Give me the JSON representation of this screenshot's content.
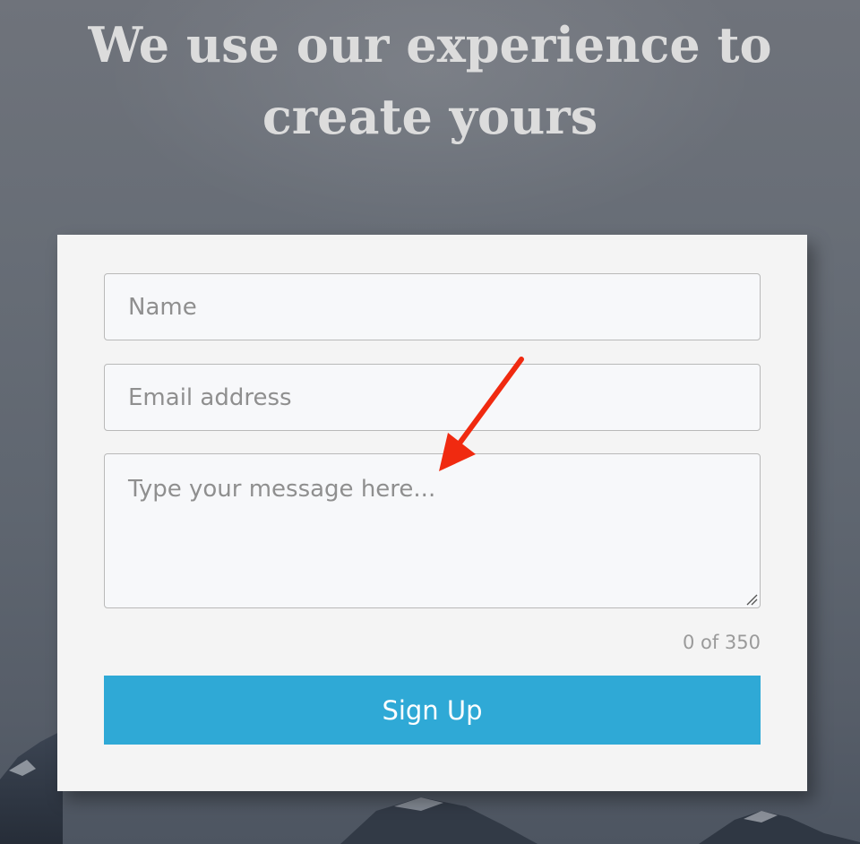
{
  "headline": {
    "line1": "We use our experience to",
    "line2": "create yours"
  },
  "form": {
    "name_placeholder": "Name",
    "email_placeholder": "Email address",
    "message_placeholder": "Type your message here...",
    "name_value": "",
    "email_value": "",
    "message_value": "",
    "char_counter": "0 of 350",
    "submit_label": "Sign Up"
  },
  "colors": {
    "button": "#2fa9d6",
    "annotation_arrow": "#f02a10",
    "card": "#f4f4f4"
  },
  "icons": {
    "annotation": "red-arrow-icon",
    "resize": "resize-grip-icon"
  }
}
